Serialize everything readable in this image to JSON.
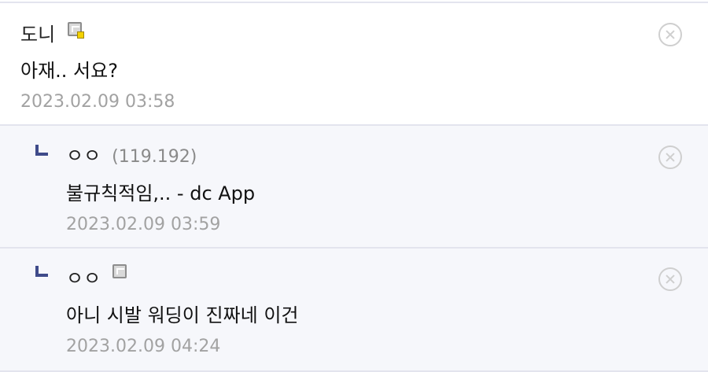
{
  "comments": [
    {
      "nickname": "도니",
      "ip": "",
      "text": "아재.. 서요?",
      "date": "2023.02.09 03:58"
    },
    {
      "nickname": "ㅇㅇ",
      "ip": "(119.192)",
      "text": "불규칙적임,.. - dc App",
      "date": "2023.02.09 03:59"
    },
    {
      "nickname": "ㅇㅇ",
      "ip": "",
      "text": "아니 시발 워딩이 진짜네 이건",
      "date": "2023.02.09 04:24"
    }
  ],
  "icons": {
    "fixed_nick_icon": "fixed-nick-icon",
    "delete_icon": "delete-icon",
    "reply_icon": "reply-arrow-icon"
  },
  "colors": {
    "reply_background": "#f6f7fb",
    "reply_arrow": "#3f4b8a",
    "divider": "#e3e4ee",
    "date_text": "#a2a2a2"
  }
}
